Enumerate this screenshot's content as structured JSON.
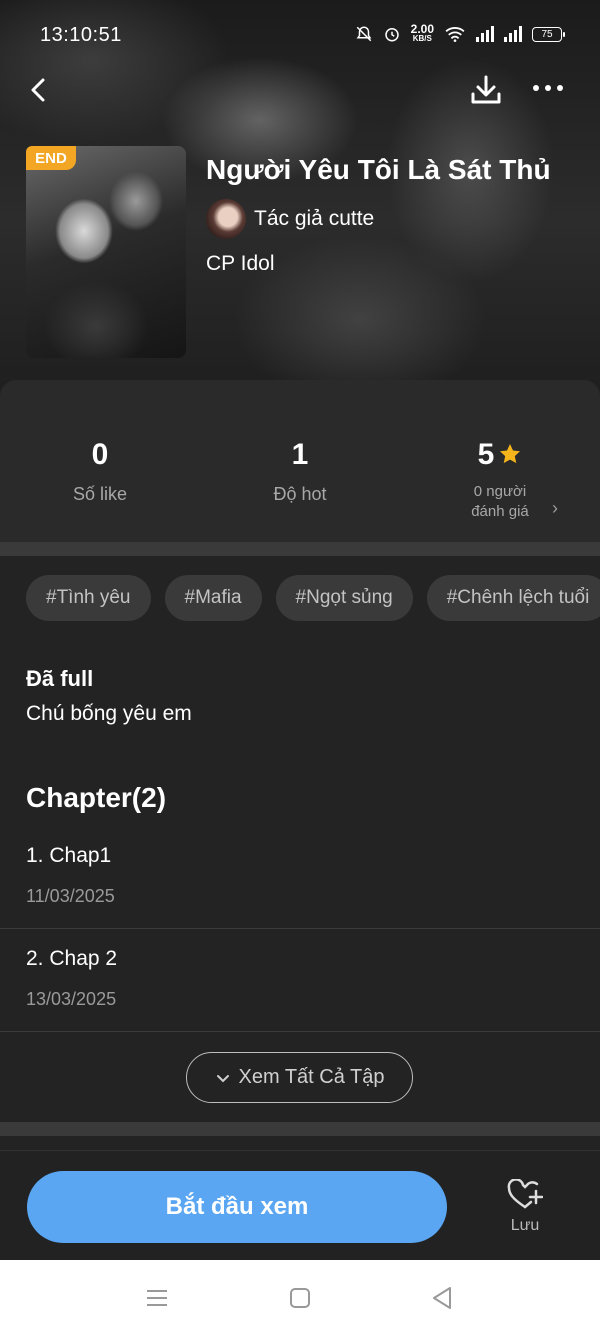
{
  "status_bar": {
    "time": "13:10:51",
    "net_speed_value": "2.00",
    "net_speed_unit": "KB/S",
    "battery": "75"
  },
  "story": {
    "badge": "END",
    "title": "Người Yêu Tôi Là Sát Thủ",
    "author": "Tác giả cutte",
    "category": "CP Idol"
  },
  "stats": [
    {
      "value": "0",
      "label": "Số like"
    },
    {
      "value": "1",
      "label": "Độ hot"
    },
    {
      "value": "5",
      "label_line1": "0 người",
      "label_line2": "đánh giá"
    }
  ],
  "tags": [
    "#Tình yêu",
    "#Mafia",
    "#Ngọt sủng",
    "#Chênh lệch tuổi"
  ],
  "description": {
    "heading": "Đã full",
    "text": "Chú bống yêu em"
  },
  "chapters_heading": "Chapter(2)",
  "chapters": [
    {
      "name": "1. Chap1",
      "date": "11/03/2025"
    },
    {
      "name": "2. Chap 2",
      "date": "13/03/2025"
    }
  ],
  "see_all_label": "Xem Tất Cả Tập",
  "start_button": "Bắt đầu xem",
  "save_label": "Lưu",
  "colors": {
    "accent": "#5aa6f2",
    "badge": "#f2a623",
    "star": "#f5b41c",
    "background": "#232323"
  }
}
